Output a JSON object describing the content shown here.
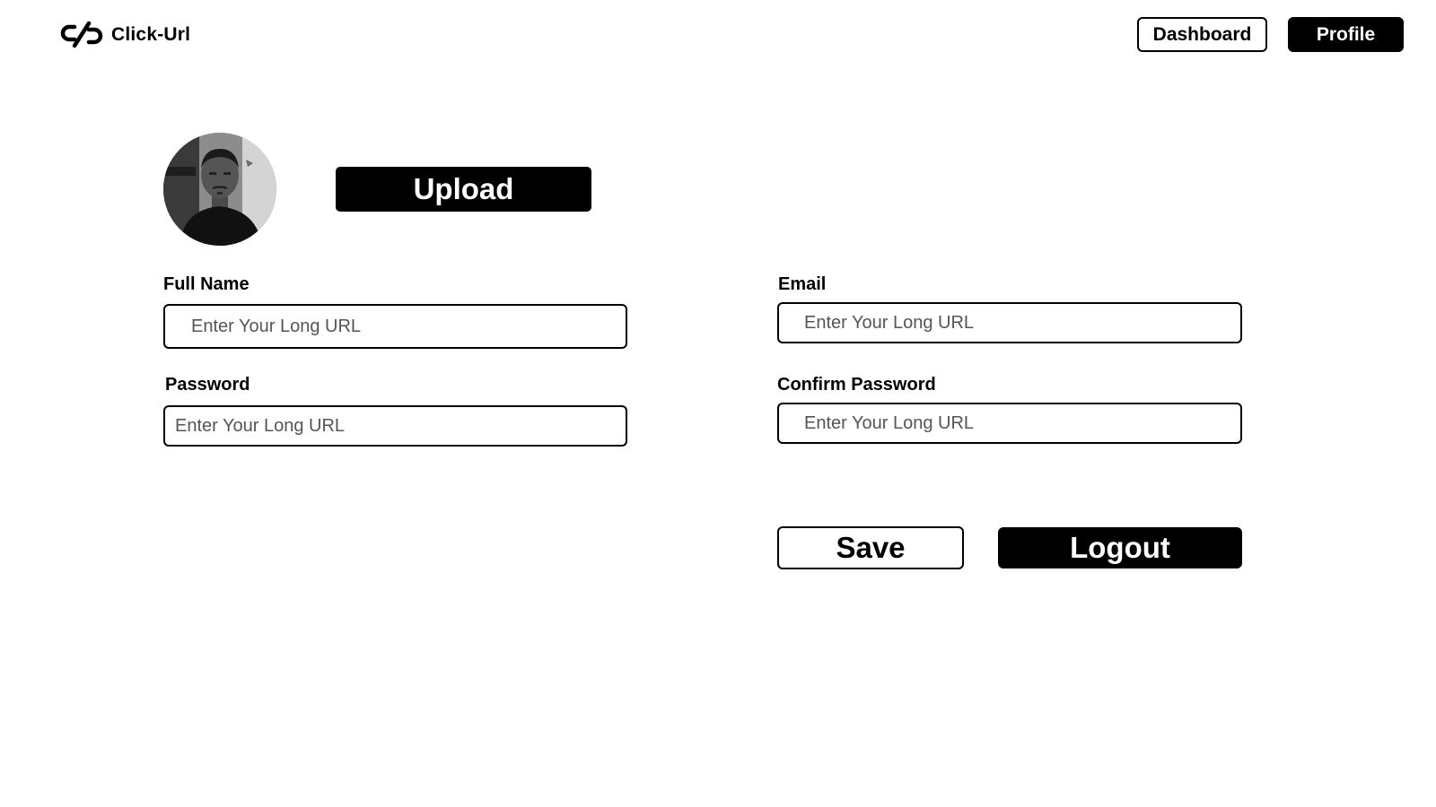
{
  "brand": {
    "name": "Click-Url",
    "logo_icon": "link-slash-icon"
  },
  "nav": {
    "dashboard_label": "Dashboard",
    "profile_label": "Profile"
  },
  "profile": {
    "avatar_icon": "user-photo",
    "upload_label": "Upload"
  },
  "form": {
    "full_name": {
      "label": "Full Name",
      "value": "",
      "placeholder": "Enter Your Long URL"
    },
    "email": {
      "label": "Email",
      "value": "",
      "placeholder": "Enter Your Long URL"
    },
    "password": {
      "label": "Password",
      "value": "",
      "placeholder": "Enter Your Long URL"
    },
    "confirm_password": {
      "label": "Confirm Password",
      "value": "",
      "placeholder": "Enter Your Long URL"
    }
  },
  "actions": {
    "save_label": "Save",
    "logout_label": "Logout"
  },
  "colors": {
    "primary": "#000000",
    "background": "#ffffff",
    "placeholder": "#555555"
  }
}
